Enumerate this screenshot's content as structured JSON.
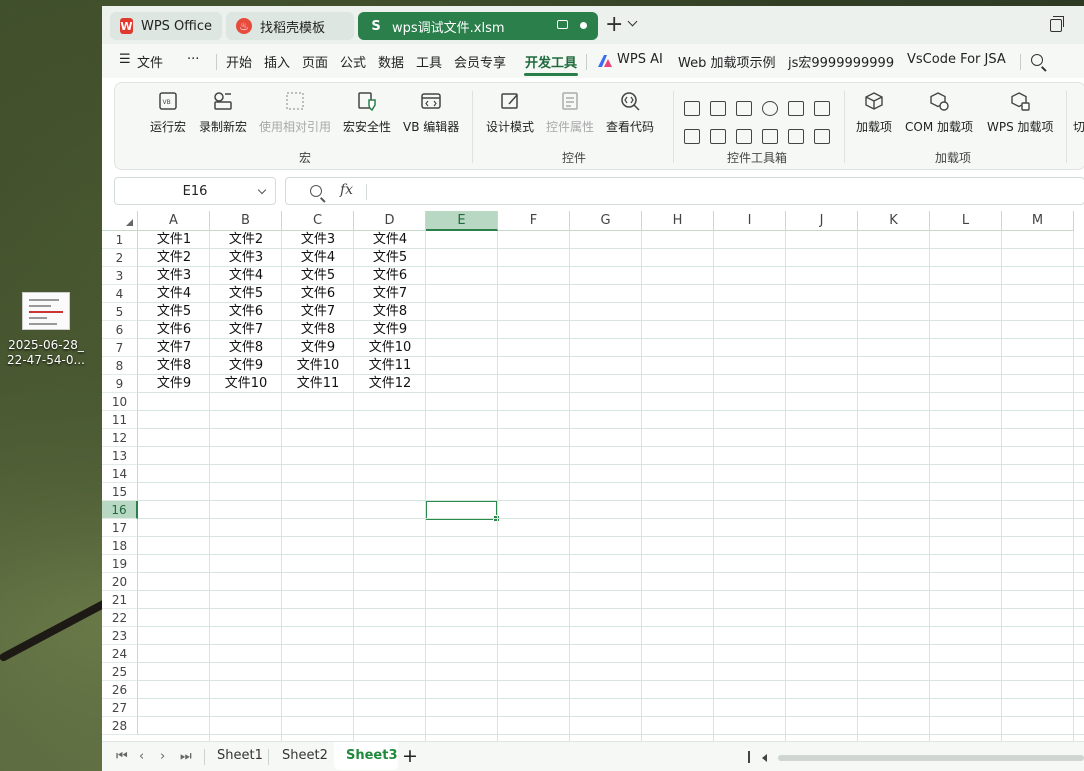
{
  "desktop": {
    "file_label_line1": "2025-06-28_",
    "file_label_line2": "22-47-54-0..."
  },
  "tabs": {
    "wps": "WPS Office",
    "templates": "找稻壳模板",
    "file": "wps调试文件.xlsm"
  },
  "menu": {
    "file": "文件",
    "more": "···",
    "home": "开始",
    "insert": "插入",
    "page": "页面",
    "formula": "公式",
    "data": "数据",
    "tools": "工具",
    "member": "会员专享",
    "developer": "开发工具",
    "wps_ai": "WPS AI",
    "web_addin": "Web 加载项示例",
    "js_macro": "js宏9999999999",
    "vscode": "VsCode For JSA"
  },
  "ribbon": {
    "run_macro": "运行宏",
    "record_macro": "录制新宏",
    "relative_ref": "使用相对引用",
    "macro_security": "宏安全性",
    "vb_editor": "VB 编辑器",
    "group_macro": "宏",
    "design_mode": "设计模式",
    "control_props": "控件属性",
    "view_code": "查看代码",
    "group_controls": "控件",
    "group_toolbox": "控件工具箱",
    "addins": "加载项",
    "com_addins": "COM 加载项",
    "wps_addins": "WPS 加载项",
    "switch": "切",
    "group_addins": "加载项"
  },
  "formula_bar": {
    "name_box": "E16",
    "fx": "fx",
    "value": ""
  },
  "columns": [
    "A",
    "B",
    "C",
    "D",
    "E",
    "F",
    "G",
    "H",
    "I",
    "J",
    "K",
    "L",
    "M"
  ],
  "selected_column": "E",
  "rows": [
    "1",
    "2",
    "3",
    "4",
    "5",
    "6",
    "7",
    "8",
    "9",
    "10",
    "11",
    "12",
    "13",
    "14",
    "15",
    "16",
    "17",
    "18",
    "19",
    "20",
    "21",
    "22",
    "23",
    "24",
    "25",
    "26",
    "27",
    "28"
  ],
  "selected_row": "16",
  "cells": [
    [
      "文件1",
      "文件2",
      "文件3",
      "文件4"
    ],
    [
      "文件2",
      "文件3",
      "文件4",
      "文件5"
    ],
    [
      "文件3",
      "文件4",
      "文件5",
      "文件6"
    ],
    [
      "文件4",
      "文件5",
      "文件6",
      "文件7"
    ],
    [
      "文件5",
      "文件6",
      "文件7",
      "文件8"
    ],
    [
      "文件6",
      "文件7",
      "文件8",
      "文件9"
    ],
    [
      "文件7",
      "文件8",
      "文件9",
      "文件10"
    ],
    [
      "文件8",
      "文件9",
      "文件10",
      "文件11"
    ],
    [
      "文件9",
      "文件10",
      "文件11",
      "文件12"
    ]
  ],
  "sheets": {
    "sheet1": "Sheet1",
    "sheet2": "Sheet2",
    "sheet3": "Sheet3",
    "add": "+"
  },
  "colors": {
    "accent": "#2a7f4b",
    "selection": "#b9d8c3",
    "active_sheet": "#1f8a3c"
  }
}
